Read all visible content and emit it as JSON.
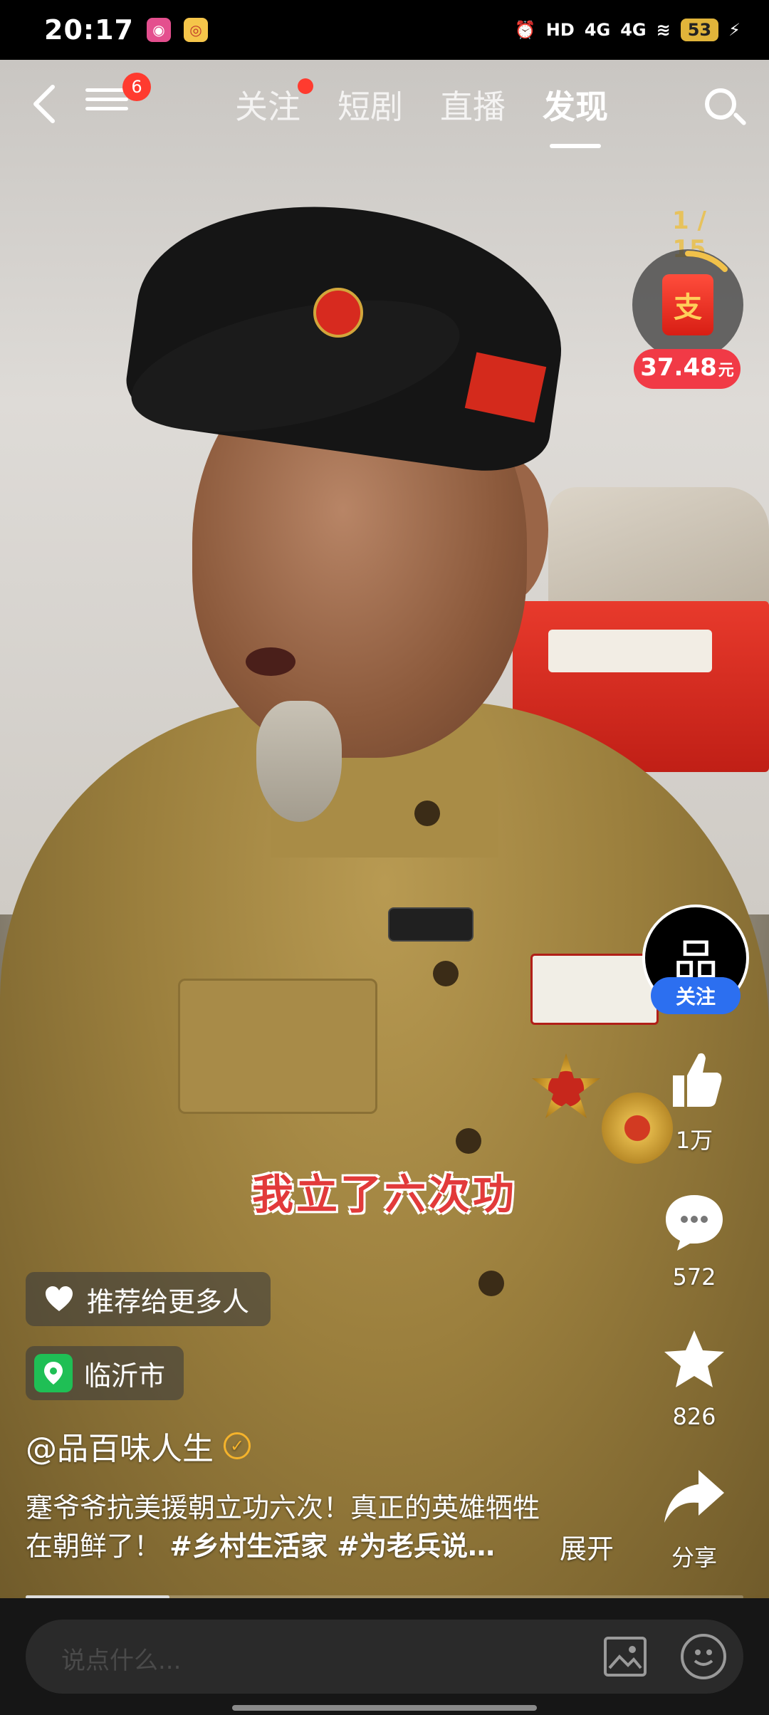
{
  "status_bar": {
    "time": "20:17",
    "app_icons": [
      "bilibili-app-icon",
      "eye-app-icon"
    ],
    "indicators": [
      "alarm-icon",
      "HD",
      "4G",
      "4G",
      "wifi-icon"
    ],
    "battery": "53"
  },
  "nav": {
    "tabs": [
      {
        "label": "关注",
        "has_dot": true
      },
      {
        "label": "短剧"
      },
      {
        "label": "直播"
      },
      {
        "label": "发现",
        "active": true
      }
    ],
    "menu_badge": "6"
  },
  "reward": {
    "progress": "1 / 15",
    "packet_glyph": "支",
    "amount": "37.48",
    "unit": "元"
  },
  "subtitle": "我立了六次功",
  "creator": {
    "avatar_text": "品",
    "follow_label": "关注",
    "handle": "@品百味人生"
  },
  "actions": {
    "likes": "1万",
    "comments": "572",
    "favorites": "826",
    "share": "分享"
  },
  "recommend_label": "推荐给更多人",
  "location": "临沂市",
  "description": {
    "line1": "蹇爷爷抗美援朝立功六次！真正的英雄牺牲",
    "line2_text": "在朝鲜了！",
    "tags": "#乡村生活家 #为老兵说…",
    "expand": "展开"
  },
  "playback": {
    "progress_fraction": 0.2
  },
  "comment_bar": {
    "placeholder": "说点什么..."
  },
  "colors": {
    "accent_red": "#ff3b2f",
    "follow_blue": "#2c6ff0",
    "amount_pill": "#f13a46"
  }
}
